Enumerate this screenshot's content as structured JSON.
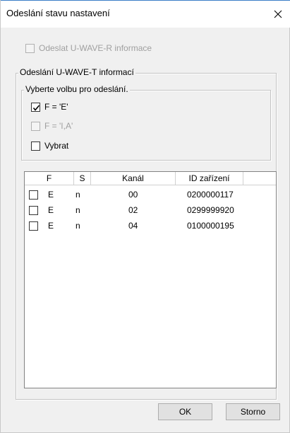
{
  "window": {
    "title": "Odeslání stavu nastavení",
    "close_icon": "close-icon"
  },
  "send_r": {
    "label": "Odeslat U-WAVE-R informace",
    "checked": false,
    "enabled": false
  },
  "group_t": {
    "caption": "Odeslání U-WAVE-T informací",
    "inner_group": {
      "caption": "Vyberte volbu pro odeslání.",
      "options": [
        {
          "label": "F = 'E'",
          "checked": true,
          "enabled": true
        },
        {
          "label": "F = 'I,A'",
          "checked": false,
          "enabled": false
        },
        {
          "label": "Vybrat",
          "checked": false,
          "enabled": true
        }
      ]
    },
    "list": {
      "columns": [
        "F",
        "S",
        "Kanál",
        "ID zařízení"
      ],
      "rows": [
        {
          "checked": false,
          "f": "E",
          "s": "n",
          "channel": "00",
          "device_id": "0200000117"
        },
        {
          "checked": false,
          "f": "E",
          "s": "n",
          "channel": "02",
          "device_id": "0299999920"
        },
        {
          "checked": false,
          "f": "E",
          "s": "n",
          "channel": "04",
          "device_id": "0100000195"
        }
      ]
    }
  },
  "buttons": {
    "ok": "OK",
    "cancel": "Storno"
  }
}
